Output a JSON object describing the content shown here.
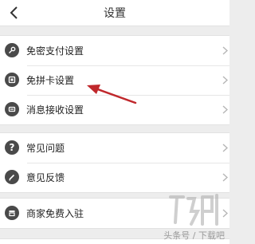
{
  "header": {
    "title": "设置"
  },
  "groups": [
    {
      "items": [
        {
          "label": "免密支付设置",
          "icon": "key-icon"
        },
        {
          "label": "免拼卡设置",
          "icon": "card-icon"
        },
        {
          "label": "消息接收设置",
          "icon": "message-icon"
        }
      ]
    },
    {
      "items": [
        {
          "label": "常见问题",
          "icon": "question-icon"
        },
        {
          "label": "意见反馈",
          "icon": "feedback-icon"
        }
      ]
    },
    {
      "items": [
        {
          "label": "商家免费入驻",
          "icon": "store-icon"
        }
      ]
    }
  ],
  "watermark": {
    "text": "头条号 / 下载吧"
  },
  "colors": {
    "icon_fill": "#4a4a4a",
    "annotation_arrow": "#c0282c",
    "page_bg": "#ededed"
  }
}
